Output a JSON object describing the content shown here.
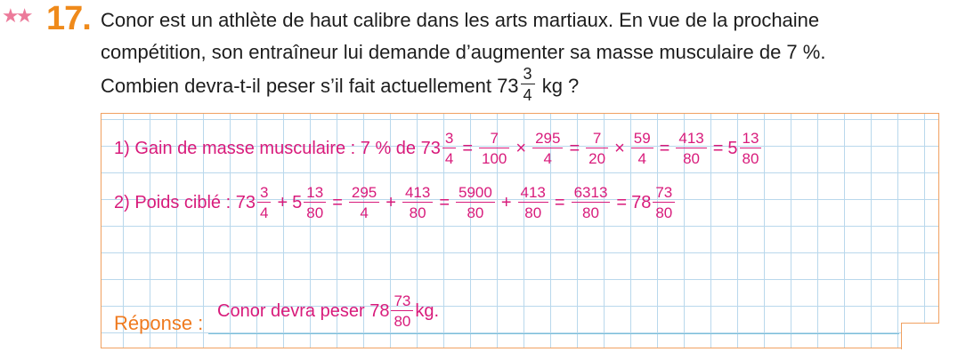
{
  "exercise": {
    "stars": "★★",
    "number": "17",
    "statement_line1": "Conor est un athlète de haut calibre dans les arts martiaux. En vue de la prochaine",
    "statement_line2": "compétition, son entraîneur lui demande d’augmenter sa masse musculaire de 7 %.",
    "statement_line3_before": "Combien devra-t-il peser s’il fait actuellement 73",
    "statement_frac_num": "3",
    "statement_frac_den": "4",
    "statement_line3_after": "kg ?"
  },
  "solution": {
    "line1": {
      "label": "1)  Gain de masse musculaire : 7 % de 73",
      "f1": [
        "3",
        "4"
      ],
      "f2": [
        "7",
        "100"
      ],
      "f3": [
        "295",
        "4"
      ],
      "f4": [
        "7",
        "20"
      ],
      "f5": [
        "59",
        "4"
      ],
      "f6": [
        "413",
        "80"
      ],
      "whole": "5",
      "f7": [
        "13",
        "80"
      ]
    },
    "line2": {
      "label": "2)  Poids ciblé : 73",
      "f1": [
        "3",
        "4"
      ],
      "mid_whole": "5",
      "f2": [
        "13",
        "80"
      ],
      "f3": [
        "295",
        "4"
      ],
      "f4": [
        "413",
        "80"
      ],
      "f5": [
        "5900",
        "80"
      ],
      "f6": [
        "413",
        "80"
      ],
      "f7": [
        "6313",
        "80"
      ],
      "whole": "78",
      "f8": [
        "73",
        "80"
      ]
    },
    "operators": {
      "eq": "=",
      "times": "×",
      "plus": "+"
    }
  },
  "answer": {
    "label": "Réponse :",
    "text_before": "Conor devra peser 78",
    "frac": [
      "73",
      "80"
    ],
    "text_after": "kg."
  }
}
